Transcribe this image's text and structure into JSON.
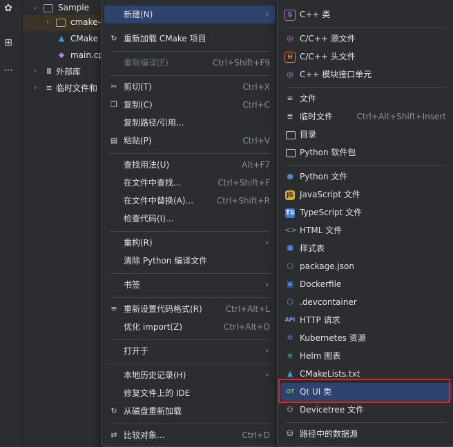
{
  "project_tree": {
    "root": "Sample",
    "items": [
      {
        "label": "cmake-"
      },
      {
        "label": "CMake"
      },
      {
        "label": "main.cp"
      },
      {
        "label": "外部库"
      },
      {
        "label": "临时文件和"
      }
    ]
  },
  "context_menu": {
    "items": [
      {
        "label": "新建(N)",
        "shortcut": ""
      },
      {
        "label": "重新加载 CMake 项目",
        "shortcut": ""
      },
      {
        "label": "重新编译(E)",
        "shortcut": "Ctrl+Shift+F9"
      },
      {
        "label": "剪切(T)",
        "shortcut": "Ctrl+X"
      },
      {
        "label": "复制(C)",
        "shortcut": "Ctrl+C"
      },
      {
        "label": "复制路径/引用...",
        "shortcut": ""
      },
      {
        "label": "粘贴(P)",
        "shortcut": "Ctrl+V"
      },
      {
        "label": "查找用法(U)",
        "shortcut": "Alt+F7"
      },
      {
        "label": "在文件中查找...",
        "shortcut": "Ctrl+Shift+F"
      },
      {
        "label": "在文件中替换(A)...",
        "shortcut": "Ctrl+Shift+R"
      },
      {
        "label": "检查代码(I)...",
        "shortcut": ""
      },
      {
        "label": "重构(R)",
        "shortcut": ""
      },
      {
        "label": "清除 Python 编译文件",
        "shortcut": ""
      },
      {
        "label": "书签",
        "shortcut": ""
      },
      {
        "label": "重新设置代码格式(R)",
        "shortcut": "Ctrl+Alt+L"
      },
      {
        "label": "优化 import(Z)",
        "shortcut": "Ctrl+Alt+O"
      },
      {
        "label": "打开于",
        "shortcut": ""
      },
      {
        "label": "本地历史记录(H)",
        "shortcut": ""
      },
      {
        "label": "修复文件上的 IDE",
        "shortcut": ""
      },
      {
        "label": "从磁盘重新加载",
        "shortcut": ""
      },
      {
        "label": "比较对象...",
        "shortcut": "Ctrl+D"
      }
    ]
  },
  "new_submenu": {
    "items": [
      {
        "label": "C++ 类",
        "shortcut": ""
      },
      {
        "label": "C/C++ 源文件",
        "shortcut": ""
      },
      {
        "label": "C/C++ 头文件",
        "shortcut": ""
      },
      {
        "label": "C++ 模块接口单元",
        "shortcut": ""
      },
      {
        "label": "文件",
        "shortcut": ""
      },
      {
        "label": "临时文件",
        "shortcut": "Ctrl+Alt+Shift+Insert"
      },
      {
        "label": "目录",
        "shortcut": ""
      },
      {
        "label": "Python 软件包",
        "shortcut": ""
      },
      {
        "label": "Python 文件",
        "shortcut": ""
      },
      {
        "label": "JavaScript 文件",
        "shortcut": ""
      },
      {
        "label": "TypeScript 文件",
        "shortcut": ""
      },
      {
        "label": "HTML 文件",
        "shortcut": ""
      },
      {
        "label": "样式表",
        "shortcut": ""
      },
      {
        "label": "package.json",
        "shortcut": ""
      },
      {
        "label": "Dockerfile",
        "shortcut": ""
      },
      {
        "label": ".devcontainer",
        "shortcut": ""
      },
      {
        "label": "HTTP 请求",
        "shortcut": ""
      },
      {
        "label": "Kubernetes 资源",
        "shortcut": ""
      },
      {
        "label": "Helm 图表",
        "shortcut": ""
      },
      {
        "label": "CMakeLists.txt",
        "shortcut": ""
      },
      {
        "label": "Qt UI 类",
        "shortcut": ""
      },
      {
        "label": "Devicetree 文件",
        "shortcut": ""
      },
      {
        "label": "路径中的数据源",
        "shortcut": ""
      }
    ],
    "icon_labels": {
      "js": "JS",
      "ts": "TS",
      "http": "API",
      "qt": "QT",
      "cpp_class": "S",
      "header": "H"
    }
  },
  "icons": [
    "refresh-icon",
    "cut-icon",
    "copy-icon",
    "paste-icon",
    "diff-icon",
    "folder-icon",
    "python-icon",
    "html-icon",
    "css-icon",
    "nodejs-icon",
    "docker-icon",
    "cube-icon",
    "kubernetes-icon",
    "helm-icon",
    "cmake-icon",
    "qt-icon",
    "database-icon"
  ],
  "colors": {
    "selection": "#2e436e",
    "highlight_border": "#d9262a",
    "menu_bg": "#2b2d30",
    "text": "#dfe1e5",
    "shortcut": "#8b8e94"
  }
}
